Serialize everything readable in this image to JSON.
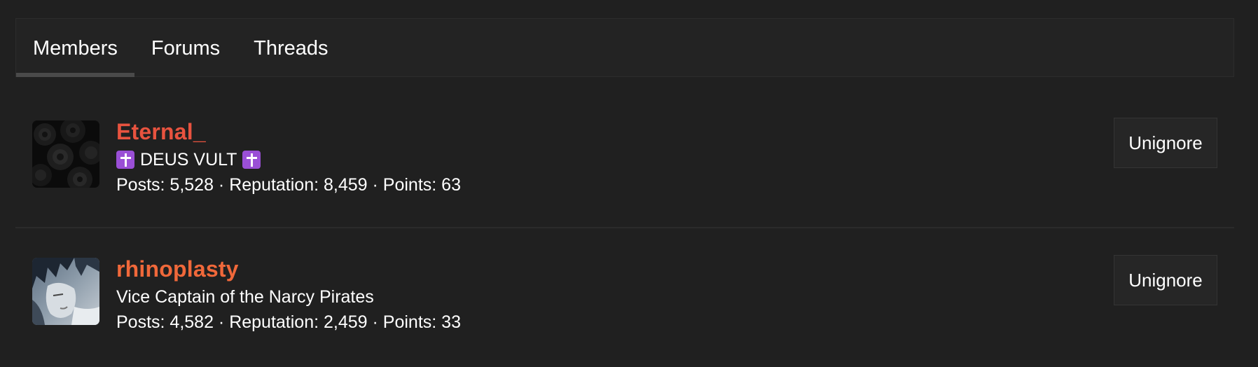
{
  "tabs": [
    {
      "label": "Members"
    },
    {
      "label": "Forums"
    },
    {
      "label": "Threads"
    }
  ],
  "members": [
    {
      "username": "Eternal_",
      "username_color": "#e8533f",
      "title": "DEUS VULT",
      "title_icon": "orthodox-cross-emoji",
      "posts": "5,528",
      "reputation": "8,459",
      "points": "63",
      "stats_text": "Posts: 5,528 · Reputation: 8,459 · Points: 63",
      "button_label": "Unignore"
    },
    {
      "username": "rhinoplasty",
      "username_color": "#f0683a",
      "title": "Vice Captain of the Narcy Pirates",
      "posts": "4,582",
      "reputation": "2,459",
      "points": "33",
      "stats_text": "Posts: 4,582 · Reputation: 2,459 · Points: 33",
      "button_label": "Unignore"
    }
  ]
}
